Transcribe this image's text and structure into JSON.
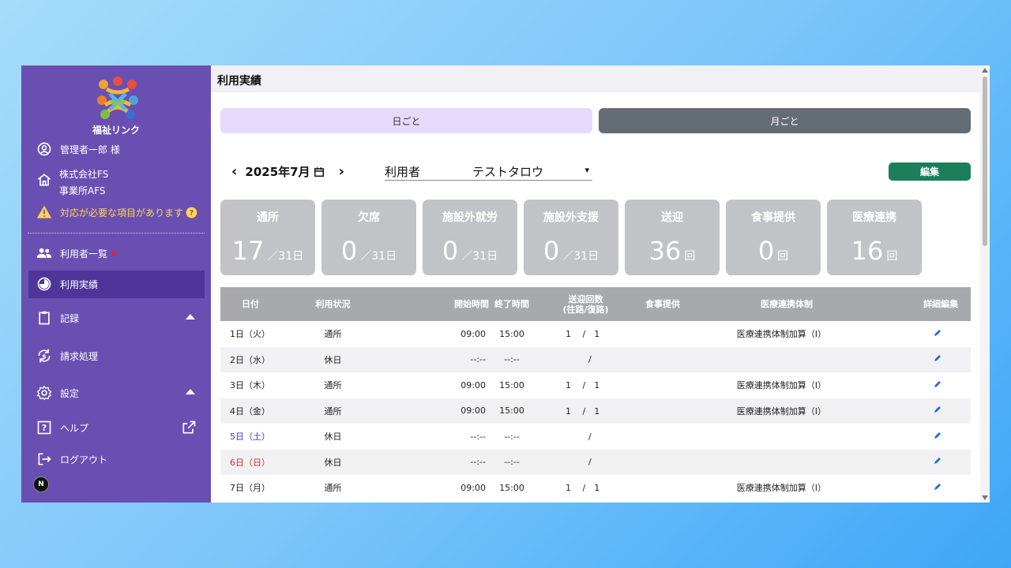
{
  "sidebar": {
    "logo_text": "福祉リンク",
    "user_name": "管理者一郎 様",
    "company_line1": "株式会社FS",
    "company_line2": "事業所AFS",
    "warning_text": "対応が必要な項目があります",
    "nav": {
      "users": "利用者一覧",
      "usage": "利用実績",
      "records": "記録",
      "billing": "請求処理",
      "settings": "設定",
      "help": "ヘルプ",
      "logout": "ログアウト"
    },
    "badge_letter": "N"
  },
  "header": {
    "title": "利用実績"
  },
  "tabs": {
    "day": "日ごと",
    "month": "月ごと"
  },
  "datebar": {
    "date": "2025年7月",
    "prev": "‹",
    "next": "›"
  },
  "user_select": {
    "label": "利用者",
    "value": "テストタロウ"
  },
  "edit_button": "編集",
  "cards": [
    {
      "title": "通所",
      "value": "17",
      "unit": "／31日"
    },
    {
      "title": "欠席",
      "value": "0",
      "unit": "／31日"
    },
    {
      "title": "施設外就労",
      "value": "0",
      "unit": "／31日"
    },
    {
      "title": "施設外支援",
      "value": "0",
      "unit": "／31日"
    },
    {
      "title": "送迎",
      "value": "36",
      "unit": "回"
    },
    {
      "title": "食事提供",
      "value": "0",
      "unit": "回"
    },
    {
      "title": "医療連携",
      "value": "16",
      "unit": "回"
    }
  ],
  "table": {
    "headers": {
      "date": "日付",
      "status": "利用状況",
      "start": "開始時間",
      "end": "終了時間",
      "transport_line1": "送迎回数",
      "transport_line2": "(往路/復路)",
      "meal": "食事提供",
      "medical": "医療連携体制",
      "detail": "詳細編集"
    },
    "rows": [
      {
        "date": "1日（火）",
        "status": "通所",
        "start": "09:00",
        "end": "15:00",
        "transport": "1　 /　1",
        "meal": "",
        "medical": "医療連携体制加算（I）",
        "day_type": ""
      },
      {
        "date": "2日（水）",
        "status": "休日",
        "start": "--:--",
        "end": "--:--",
        "transport": "/",
        "meal": "",
        "medical": "",
        "day_type": ""
      },
      {
        "date": "3日（木）",
        "status": "通所",
        "start": "09:00",
        "end": "15:00",
        "transport": "1　 /　1",
        "meal": "",
        "medical": "医療連携体制加算（I）",
        "day_type": ""
      },
      {
        "date": "4日（金）",
        "status": "通所",
        "start": "09:00",
        "end": "15:00",
        "transport": "1　 /　1",
        "meal": "",
        "medical": "医療連携体制加算（I）",
        "day_type": ""
      },
      {
        "date": "5日（土）",
        "status": "休日",
        "start": "--:--",
        "end": "--:--",
        "transport": "/",
        "meal": "",
        "medical": "",
        "day_type": "sat"
      },
      {
        "date": "6日（日）",
        "status": "休日",
        "start": "--:--",
        "end": "--:--",
        "transport": "/",
        "meal": "",
        "medical": "",
        "day_type": "sun"
      },
      {
        "date": "7日（月）",
        "status": "通所",
        "start": "09:00",
        "end": "15:00",
        "transport": "1　 /　1",
        "meal": "",
        "medical": "医療連携体制加算（I）",
        "day_type": ""
      }
    ]
  },
  "colors": {
    "sidebar": "#6a4fb3",
    "sidebar_active": "#4f3599",
    "warning": "#ffd54a",
    "edit_button": "#1a7f5a",
    "card": "#c2c3c6",
    "tab_day": "#e6dafc",
    "tab_month": "#656d74",
    "saturday": "#2a3fcf",
    "sunday": "#d62a2a",
    "pencil": "#1f6fd1"
  }
}
